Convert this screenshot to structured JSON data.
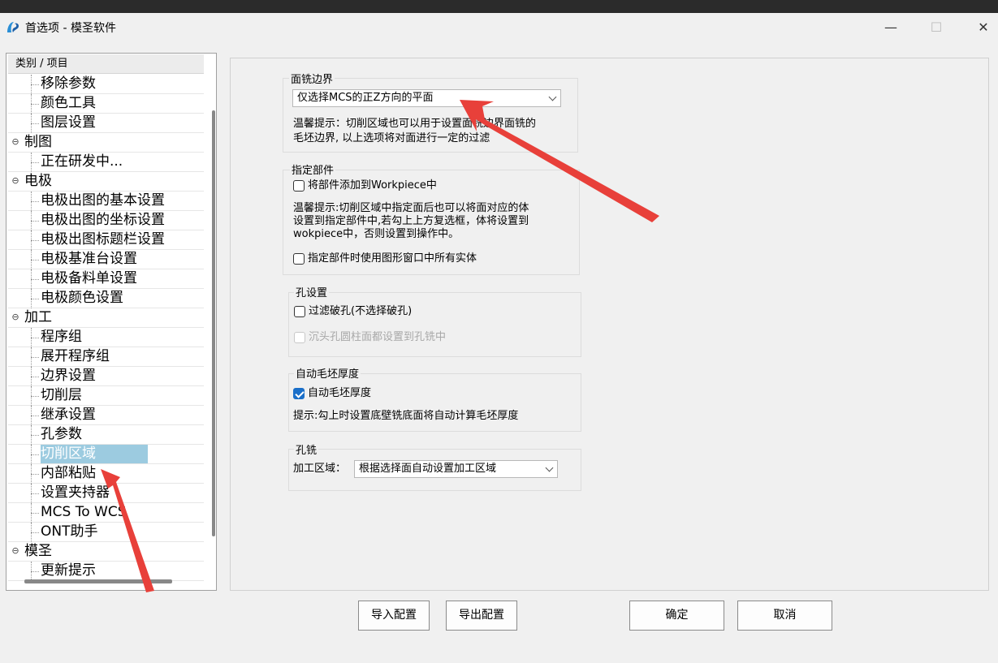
{
  "window": {
    "title": "首选项 - 模圣软件",
    "controls": {
      "minimize": "—",
      "maximize": "☐",
      "close": "✕"
    }
  },
  "tree": {
    "header": "类别 / 项目",
    "rows": [
      {
        "type": "child",
        "label": "移除参数"
      },
      {
        "type": "child",
        "label": "颜色工具"
      },
      {
        "type": "child",
        "label": "图层设置"
      },
      {
        "type": "parent",
        "label": "制图",
        "toggle": "⊖"
      },
      {
        "type": "child",
        "label": "正在研发中..."
      },
      {
        "type": "parent",
        "label": "电极",
        "toggle": "⊖"
      },
      {
        "type": "child",
        "label": "电极出图的基本设置"
      },
      {
        "type": "child",
        "label": "电极出图的坐标设置"
      },
      {
        "type": "child",
        "label": "电极出图标题栏设置"
      },
      {
        "type": "child",
        "label": "电极基准台设置"
      },
      {
        "type": "child",
        "label": "电极备料单设置"
      },
      {
        "type": "child",
        "label": "电极颜色设置"
      },
      {
        "type": "parent",
        "label": "加工",
        "toggle": "⊖"
      },
      {
        "type": "child",
        "label": "程序组"
      },
      {
        "type": "child",
        "label": "展开程序组"
      },
      {
        "type": "child",
        "label": "边界设置"
      },
      {
        "type": "child",
        "label": "切削层"
      },
      {
        "type": "child",
        "label": "继承设置"
      },
      {
        "type": "child",
        "label": "孔参数"
      },
      {
        "type": "child",
        "label": "切削区域",
        "selected": true
      },
      {
        "type": "child",
        "label": "内部粘贴"
      },
      {
        "type": "child",
        "label": "设置夹持器"
      },
      {
        "type": "child",
        "label": "MCS To WCS"
      },
      {
        "type": "child",
        "label": "ONT助手"
      },
      {
        "type": "parent",
        "label": "模圣",
        "toggle": "⊖"
      },
      {
        "type": "child",
        "label": "更新提示"
      }
    ]
  },
  "face_mill_boundary": {
    "title": "面铣边界",
    "combo_value": "仅选择MCS的正Z方向的平面",
    "hint_line1": "温馨提示：切削区域也可以用于设置面铣边界面铣的",
    "hint_line2": "毛坯边界, 以上选项将对面进行一定的过滤"
  },
  "assign_part": {
    "title": "指定部件",
    "checkbox1_label": "将部件添加到Workpiece中",
    "checkbox1_checked": false,
    "hint_line1": "温馨提示:切削区域中指定面后也可以将面对应的体",
    "hint_line2": "设置到指定部件中,若勾上上方复选框，体将设置到",
    "hint_line3": "wokpiece中，否则设置到操作中。",
    "checkbox2_label": "指定部件时使用图形窗口中所有实体",
    "checkbox2_checked": false
  },
  "hole_settings": {
    "title": "孔设置",
    "filter_label": "过滤破孔(不选择破孔)",
    "filter_checked": false,
    "counterbore_label": "沉头孔圆柱面都设置到孔铣中",
    "counterbore_enabled": false
  },
  "auto_blank": {
    "title": "自动毛坯厚度",
    "checkbox_label": "自动毛坯厚度",
    "checked": true,
    "hint": "提示:勾上时设置底壁铣底面将自动计算毛坯厚度"
  },
  "hole_mill": {
    "title": "孔铣",
    "area_label": "加工区域：",
    "area_value": "根据选择面自动设置加工区域"
  },
  "buttons": {
    "import": "导入配置",
    "export": "导出配置",
    "ok": "确定",
    "cancel": "取消"
  },
  "colors": {
    "selection": "#9ccbe0",
    "annotation_arrow": "#e8403a",
    "checkbox_checked": "#1a6fc9"
  }
}
